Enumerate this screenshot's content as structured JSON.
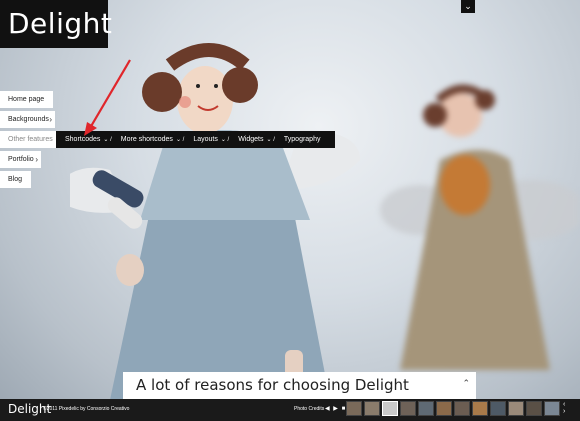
{
  "header": {
    "logo": "Delight",
    "toggle_icon": "chevron-down-icon"
  },
  "sidebar": {
    "items": [
      {
        "label": "Home page",
        "has_chevron": false
      },
      {
        "label": "Backgrounds",
        "has_chevron": true
      },
      {
        "label": "Other features",
        "has_chevron": false
      },
      {
        "label": "Portfolio",
        "has_chevron": true
      },
      {
        "label": "Blog",
        "has_chevron": false
      }
    ]
  },
  "submenu": {
    "items": [
      {
        "label": "Shortcodes",
        "suffix": "⌄ /"
      },
      {
        "label": "More shortcodes",
        "suffix": "⌄ /"
      },
      {
        "label": "Layouts",
        "suffix": "⌄ /"
      },
      {
        "label": "Widgets",
        "suffix": "⌄ /"
      },
      {
        "label": "Typography",
        "suffix": ""
      }
    ]
  },
  "caption": {
    "title": "A lot of reasons for choosing Delight",
    "collapse_icon": "chevron-up-icon"
  },
  "footer": {
    "logo": "Delight",
    "copyright": "©2011 Pixedelic by Consorzio Creativo",
    "credits_label": "Photo Credits",
    "controls": "◀ ▶ ■",
    "thumb_colors": [
      "#7a6a5a",
      "#8a7c6c",
      "#c9c9c9",
      "#6e6258",
      "#5f6a74",
      "#8b6a4a",
      "#6b5d52",
      "#a87a4a",
      "#4e5a66",
      "#9a8a7a",
      "#5a5046",
      "#7b8794"
    ],
    "active_thumb": 2
  },
  "colors": {
    "accent": "#111111",
    "arrow": "#e0262b"
  }
}
